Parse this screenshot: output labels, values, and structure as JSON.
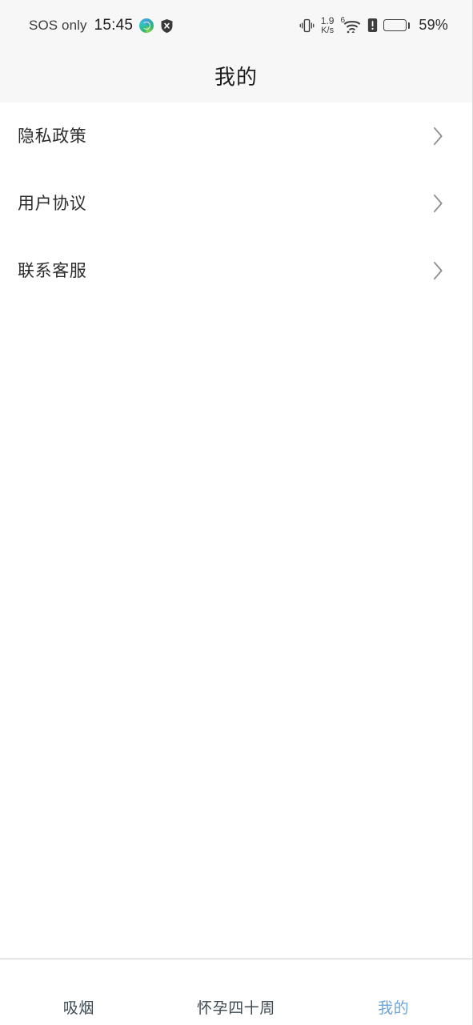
{
  "status_bar": {
    "carrier": "SOS only",
    "time": "15:45",
    "icons_left": [
      "gradient-globe-icon",
      "shield-x-icon"
    ],
    "vibrate_icon": "vibrate-icon",
    "network_speed_value": "1.9",
    "network_speed_unit": "K/s",
    "wifi_generation": "6",
    "wifi_icon": "wifi-icon",
    "sim_alert_icon": "sim-alert-icon",
    "battery_percent_label": "59%",
    "battery_level": 59
  },
  "header": {
    "title": "我的"
  },
  "list": {
    "items": [
      {
        "label": "隐私政策",
        "chevron": "chevron-right-icon"
      },
      {
        "label": "用户协议",
        "chevron": "chevron-right-icon"
      },
      {
        "label": "联系客服",
        "chevron": "chevron-right-icon"
      }
    ]
  },
  "tab_bar": {
    "items": [
      {
        "label": "吸烟",
        "active": false
      },
      {
        "label": "怀孕四十周",
        "active": false
      },
      {
        "label": "我的",
        "active": true
      }
    ],
    "active_color": "#6ca5dc",
    "inactive_color": "#3e4a52"
  },
  "colors": {
    "status_bar_bg": "#f7f7f7",
    "header_bg": "#f7f7f7",
    "content_bg": "#ffffff",
    "text_primary": "#2c2c2c",
    "chevron": "#8c8c8c",
    "divider": "#cfcfcf"
  }
}
